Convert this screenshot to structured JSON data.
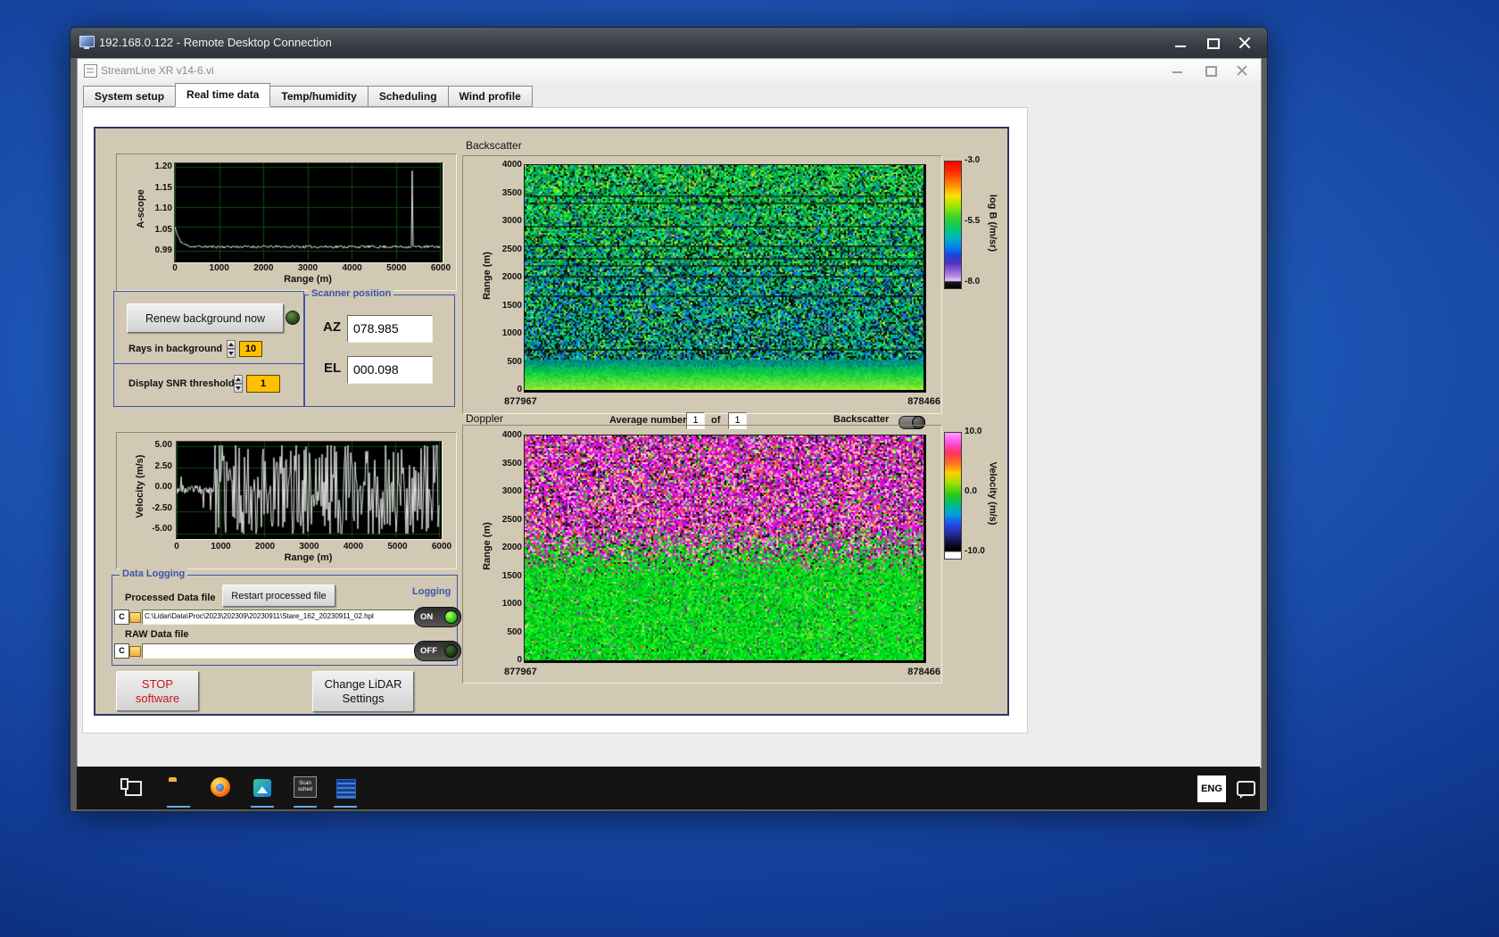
{
  "colors": {
    "panel-tan": "#d2c9b4",
    "accent-blue": "#3a55a8",
    "value-yellow": "#ffc000",
    "led-on-green": "#2ecc10"
  },
  "rdp": {
    "title": "192.168.0.122 - Remote Desktop Connection"
  },
  "app": {
    "title": "StreamLine XR v14-6.vi",
    "tabs": [
      "System setup",
      "Real time data",
      "Temp/humidity",
      "Scheduling",
      "Wind profile"
    ],
    "active_tab": "Real time data"
  },
  "ascope": {
    "ylabel": "A-scope",
    "yticks": [
      "1.20",
      "1.15",
      "1.10",
      "1.05",
      "0.99"
    ],
    "xticks": [
      "0",
      "1000",
      "2000",
      "3000",
      "4000",
      "5000",
      "6000"
    ],
    "xlabel": "Range (m)"
  },
  "background_ctrl": {
    "renew_button": "Renew background now",
    "rays_label": "Rays in background",
    "rays_value": "10",
    "snr_label": "Display SNR threshold",
    "snr_value": "1"
  },
  "scanner": {
    "title": "Scanner position",
    "az_label": "AZ",
    "az_value": "078.985",
    "el_label": "EL",
    "el_value": "000.098"
  },
  "backscatter": {
    "title": "Backscatter",
    "ylabel": "Range (m)",
    "yticks": [
      "4000",
      "3500",
      "3000",
      "2500",
      "2000",
      "1500",
      "1000",
      "500",
      "0"
    ],
    "x_left": "877967",
    "x_right": "878466",
    "cb_ticks": [
      "-3.0",
      "-5.5",
      "-8.0"
    ],
    "cb_label": "log B (/m/sr)"
  },
  "doppler": {
    "title": "Doppler",
    "avg_label": "Average number",
    "avg_value": "1",
    "of_label": "of",
    "of_value": "1",
    "toggle_label": "Backscatter",
    "ylabel": "Range (m)",
    "yticks": [
      "4000",
      "3500",
      "3000",
      "2500",
      "2000",
      "1500",
      "1000",
      "500",
      "0"
    ],
    "x_left": "877967",
    "x_right": "878466",
    "cb_ticks": [
      "10.0",
      "0.0",
      "-10.0"
    ],
    "cb_label": "Velocity (m/s)"
  },
  "velocity": {
    "ylabel": "Velocity (m/s)",
    "yticks": [
      "5.00",
      "2.50",
      "0.00",
      "-2.50",
      "-5.00"
    ],
    "xticks": [
      "0",
      "1000",
      "2000",
      "3000",
      "4000",
      "5000",
      "6000"
    ],
    "xlabel": "Range (m)"
  },
  "logging": {
    "title": "Data Logging",
    "processed_label": "Processed Data file",
    "restart_button": "Restart processed file",
    "logging_label": "Logging",
    "drive": "C",
    "processed_path": "C:\\Lidar\\Data\\Proc\\2023\\202309\\20230911\\Stare_162_20230911_02.hpl",
    "on_label": "ON",
    "raw_label": "RAW Data file",
    "raw_path": "",
    "off_label": "OFF"
  },
  "actions": {
    "stop_line1": "STOP",
    "stop_line2": "software",
    "change_line1": "Change LiDAR",
    "change_line2": "Settings"
  },
  "taskbar": {
    "lang": "ENG",
    "scan_line1": "Scan",
    "scan_line2": "sched"
  }
}
